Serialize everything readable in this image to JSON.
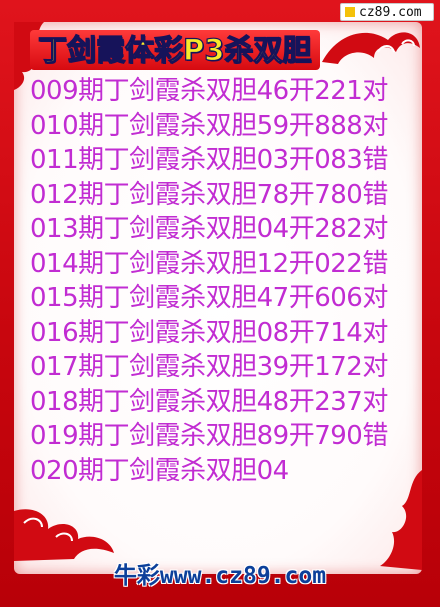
{
  "badge": {
    "text": "cz89.com",
    "icon": "yellow-square-icon"
  },
  "title": "丁剑霞体彩P3杀双胆",
  "rows": [
    "009期丁剑霞杀双胆46开221对",
    "010期丁剑霞杀双胆59开888对",
    "011期丁剑霞杀双胆03开083错",
    "012期丁剑霞杀双胆78开780错",
    "013期丁剑霞杀双胆04开282对",
    "014期丁剑霞杀双胆12开022错",
    "015期丁剑霞杀双胆47开606对",
    "016期丁剑霞杀双胆08开714对",
    "017期丁剑霞杀双胆39开172对",
    "018期丁剑霞杀双胆48开237对",
    "019期丁剑霞杀双胆89开790错",
    "020期丁剑霞杀双胆04"
  ],
  "footer": "牛彩www.cz89.com",
  "colors": {
    "frame": "#c8060e",
    "text": "#c12cd2",
    "title": "#f7ea2a",
    "footer": "#0c3f9a"
  }
}
